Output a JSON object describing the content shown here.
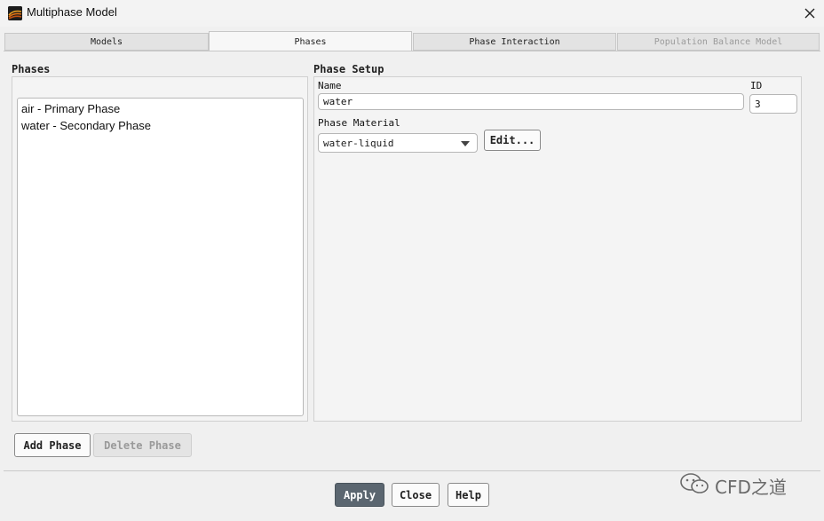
{
  "window": {
    "title": "Multiphase Model",
    "icon": "fluent-app-icon",
    "close_icon": "close-icon"
  },
  "tabs": [
    {
      "label": "Models",
      "active": false,
      "disabled": false
    },
    {
      "label": "Phases",
      "active": true,
      "disabled": false
    },
    {
      "label": "Phase Interaction",
      "active": false,
      "disabled": false
    },
    {
      "label": "Population Balance Model",
      "active": false,
      "disabled": true
    }
  ],
  "phases": {
    "heading": "Phases",
    "items": [
      "air - Primary Phase",
      "water - Secondary Phase"
    ],
    "add_button": "Add Phase",
    "delete_button": "Delete Phase"
  },
  "setup": {
    "heading": "Phase Setup",
    "name_label": "Name",
    "name_value": "water",
    "id_label": "ID",
    "id_value": "3",
    "material_label": "Phase Material",
    "material_value": "water-liquid",
    "edit_button": "Edit..."
  },
  "footer": {
    "apply": "Apply",
    "close": "Close",
    "help": "Help"
  },
  "watermark": {
    "text": "CFD之道",
    "icon": "wechat-icon"
  }
}
